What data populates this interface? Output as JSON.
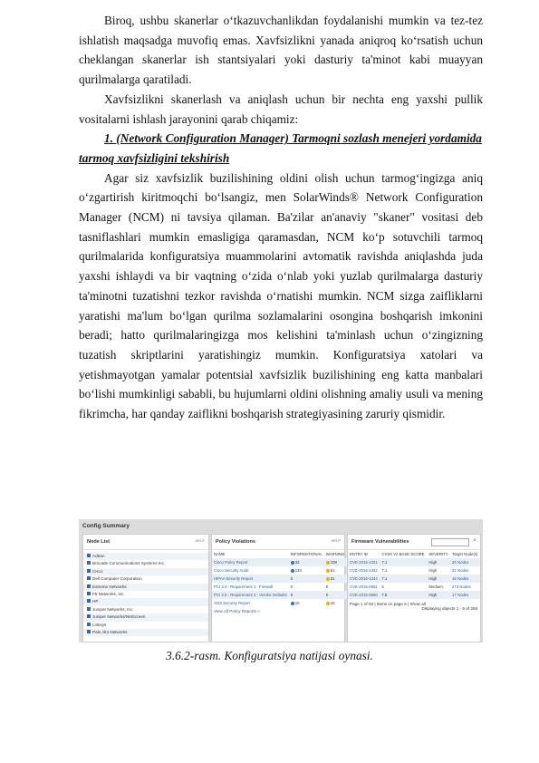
{
  "paragraphs": [
    "Biroq, ushbu skanerlar o‘tkazuvchanlikdan foydalanishi mumkin va tez-tez ishlatish maqsadga muvofiq emas. Xavfsizlikni yanada aniqroq ko‘rsatish uchun cheklangan skanerlar ish stantsiyalari yoki dasturiy ta'minot kabi muayyan qurilmalarga qaratiladi.",
    "Xavfsizlikni skanerlash va aniqlash uchun bir nechta eng yaxshi pullik vositalarni ishlash jarayonini qarab chiqamiz:"
  ],
  "heading": "1. (Network Configuration Manager) Tarmoqni sozlash menejeri yordamida tarmoq xavfsizligini tekshirish",
  "paragraph3": "Agar siz xavfsizlik buzilishining oldini olish uchun tarmog‘ingizga aniq o‘zgartirish kiritmoqchi bo‘lsangiz, men SolarWinds® Network Configuration Manager (NCM) ni tavsiya qilaman. Ba'zilar an'anaviy \"skaner\" vositasi deb tasniflashlari mumkin emasligiga qaramasdan, NCM ko‘p sotuvchili tarmoq qurilmalarida konfiguratsiya muammolarini avtomatik ravishda aniqlashda juda yaxshi ishlaydi va bir vaqtning o‘zida o‘nlab yoki yuzlab qurilmalarga dasturiy ta'minotni tuzatishni tezkor ravishda o‘rnatishi mumkin. NCM sizga zaifliklarni yaratishi ma'lum bo‘lgan qurilma sozlamalarini osongina boshqarish imkonini beradi; hatto qurilmalaringizga mos kelishini ta'minlash uchun o‘zingizning tuzatish skriptlarini yaratishingiz mumkin. Konfiguratsiya xatolari va yetishmayotgan yamalar potentsial xavfsizlik buzilishining eng katta manbalari bo‘lishi mumkinligi sababli, bu hujumlarni oldini olishning amaliy usuli va mening fikrimcha, har qanday zaiflikni boshqarish strategiyasining zaruriy qismidir.",
  "figure": {
    "title": "Config Summary",
    "help": "HELP",
    "node_list": {
      "title": "Node List",
      "items": [
        "Adtran",
        "Brocade Communications Systems Inc.",
        "Cisco",
        "Dell Computer Corporation",
        "Extreme Networks",
        "F5 Networks, Inc.",
        "HP",
        "Juniper Networks, Inc.",
        "Juniper Networks/NetScreen",
        "Linksys",
        "Palo Alto Networks"
      ]
    },
    "policy": {
      "title": "Policy Violations",
      "headers": [
        "NAME",
        "INFORMATIONAL",
        "WARNING",
        "CRITICAL"
      ],
      "rows": [
        [
          "Cisco Policy Report",
          "32",
          "108",
          "98"
        ],
        [
          "Cisco Security Audit",
          "134",
          "51",
          "57"
        ],
        [
          "HIPAA Security Report",
          "0",
          "51",
          "24"
        ],
        [
          "PCI 3.0 - Requirement 1 - Firewall",
          "0",
          "0",
          "1368"
        ],
        [
          "PCI 3.0 - Requirement 2 - Vendor Defaults",
          "0",
          "0",
          "849"
        ],
        [
          "SOX Security Report",
          "10",
          "16",
          "22"
        ]
      ],
      "view_all": "View All Policy Reports »"
    },
    "firmware": {
      "title": "Firmware Vulnerabilities",
      "headers": [
        "ENTRY ID",
        "CVSS V2 BASE SCORE",
        "SEVERITY",
        "Target Node(s)"
      ],
      "rows": [
        [
          "CVE-2016-1341",
          "7.1",
          "High",
          "26 Nodes"
        ],
        [
          "CVE-2016-1342",
          "7.1",
          "High",
          "21 Nodes"
        ],
        [
          "CVE-2016-1344",
          "7.1",
          "High",
          "16 Nodes"
        ],
        [
          "CVE-2015-0651",
          "5",
          "Medium",
          "273 Nodes"
        ],
        [
          "CVE-2015-0650",
          "7.8",
          "High",
          "17 Nodes"
        ]
      ],
      "pager": "Page 1 of 53 | Items on page 5 | Show all",
      "displaying": "Displaying objects 1 - 5 of 259"
    }
  },
  "caption": "3.6.2-rasm. Konfiguratsiya natijasi oynasi.",
  "colors": {
    "info": "#2f6fb7",
    "warning": "#e8b400",
    "critical": "#d23a1e"
  }
}
